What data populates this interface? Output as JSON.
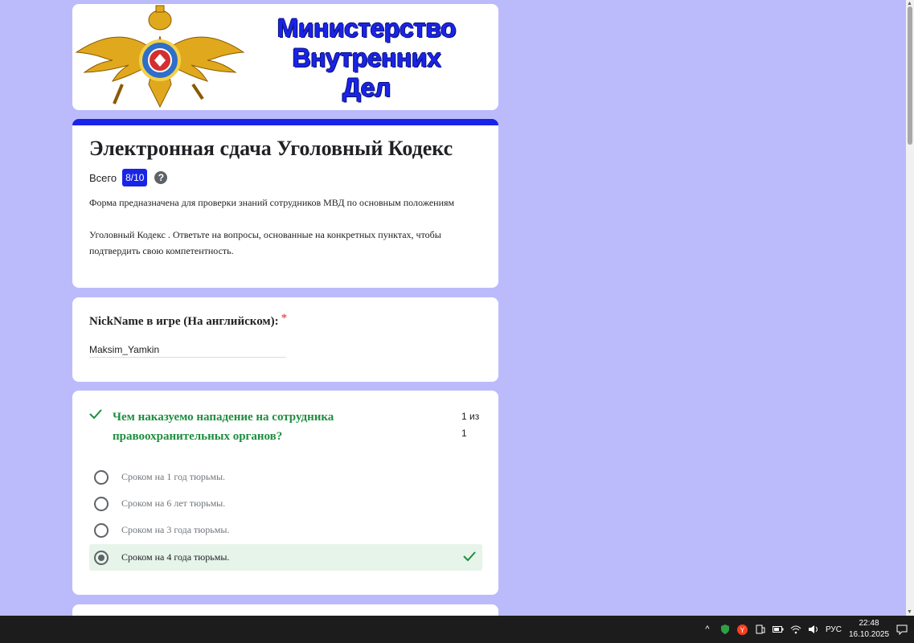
{
  "banner": {
    "title_lines": [
      "Министерство",
      "Внутренних",
      "Дел"
    ]
  },
  "header": {
    "title": "Электронная сдача Уголовный Кодекс",
    "score_label": "Всего",
    "score_value": "8/10",
    "help_glyph": "?",
    "desc_p1": "Форма предназначена для проверки знаний сотрудников МВД по основным положениям",
    "desc_p2": "Уголовный Кодекс . Ответьте на вопросы, основанные на конкретных пунктах, чтобы подтвердить свою компетентность."
  },
  "nickname": {
    "label": "NickName в игре (На английском):",
    "required_mark": "*",
    "value": "Maksim_Yamkin"
  },
  "question1": {
    "text": "Чем наказуемо нападение на сотрудника правоохранительных органов?",
    "points_line1": "1 из",
    "points_line2": "1",
    "options": [
      {
        "label": "Сроком на 1 год тюрьмы.",
        "selected": false
      },
      {
        "label": "Сроком на 6 лет тюрьмы.",
        "selected": false
      },
      {
        "label": "Сроком на 3 года тюрьмы.",
        "selected": false
      },
      {
        "label": "Сроком на 4 года тюрьмы.",
        "selected": true,
        "correct": true
      }
    ]
  },
  "taskbar": {
    "language": "РУС",
    "time": "22:48",
    "date": "16.10.2025",
    "icons": [
      "chevron-up-icon",
      "shield-icon",
      "yandex-icon",
      "tablet-mode-icon",
      "battery-icon",
      "wifi-icon",
      "volume-icon",
      "notifications-icon"
    ]
  },
  "colors": {
    "background": "#bbbbfb",
    "accent": "#1a24e6",
    "correct": "#1e8e3e",
    "correct_bg": "#e6f4ea"
  }
}
